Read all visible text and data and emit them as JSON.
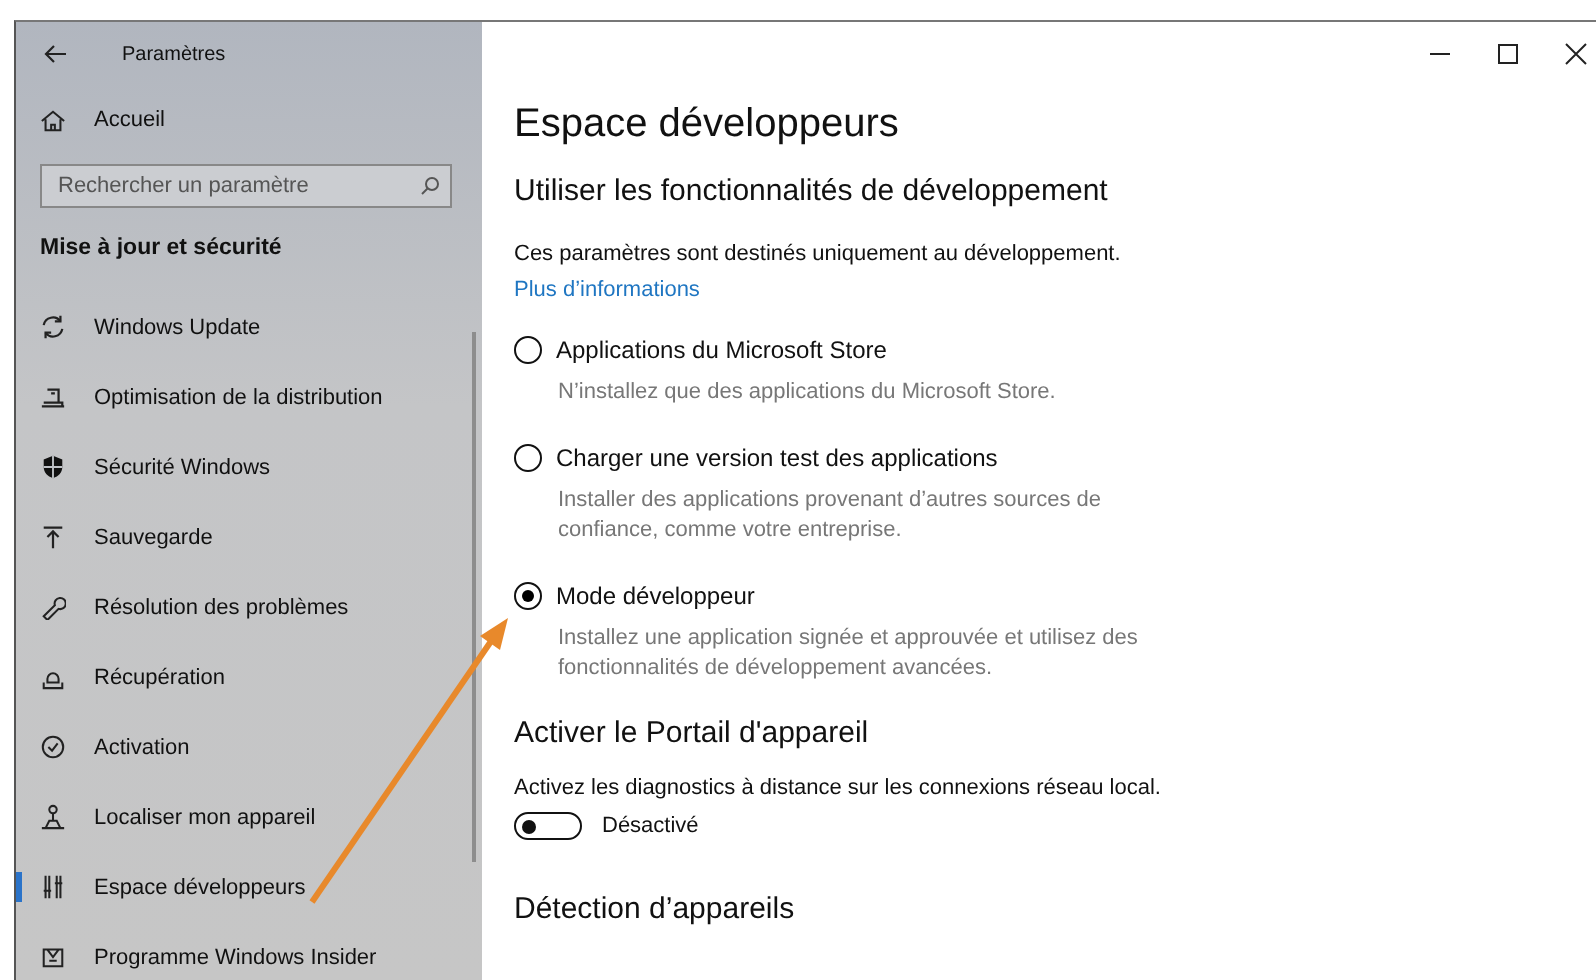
{
  "window": {
    "title": "Paramètres"
  },
  "sidebar": {
    "home": {
      "label": "Accueil"
    },
    "search": {
      "placeholder": "Rechercher un paramètre"
    },
    "section": "Mise à jour et sécurité",
    "items": [
      {
        "label": "Windows Update",
        "selected": false
      },
      {
        "label": "Optimisation de la distribution",
        "selected": false
      },
      {
        "label": "Sécurité Windows",
        "selected": false
      },
      {
        "label": "Sauvegarde",
        "selected": false
      },
      {
        "label": "Résolution des problèmes",
        "selected": false
      },
      {
        "label": "Récupération",
        "selected": false
      },
      {
        "label": "Activation",
        "selected": false
      },
      {
        "label": "Localiser mon appareil",
        "selected": false
      },
      {
        "label": "Espace développeurs",
        "selected": true
      },
      {
        "label": "Programme Windows Insider",
        "selected": false
      }
    ]
  },
  "content": {
    "title": "Espace développeurs",
    "subtitle": "Utiliser les fonctionnalités de développement",
    "description": "Ces paramètres sont destinés uniquement au développement.",
    "link": "Plus d’informations",
    "options": [
      {
        "label": "Applications du Microsoft Store",
        "description": "N’installez que des applications du Microsoft Store.",
        "selected": false
      },
      {
        "label": "Charger une version test des applications",
        "description": "Installer des applications provenant d’autres sources de confiance, comme votre entreprise.",
        "selected": false
      },
      {
        "label": "Mode développeur",
        "description": "Installez une application signée et approuvée et utilisez des fonctionnalités de développement avancées.",
        "selected": true
      }
    ],
    "portal": {
      "heading": "Activer le Portail d'appareil",
      "description": "Activez les diagnostics à distance sur les connexions réseau local.",
      "toggle": {
        "on": false,
        "label": "Désactivé"
      }
    },
    "next_heading": "Détection d’appareils"
  }
}
